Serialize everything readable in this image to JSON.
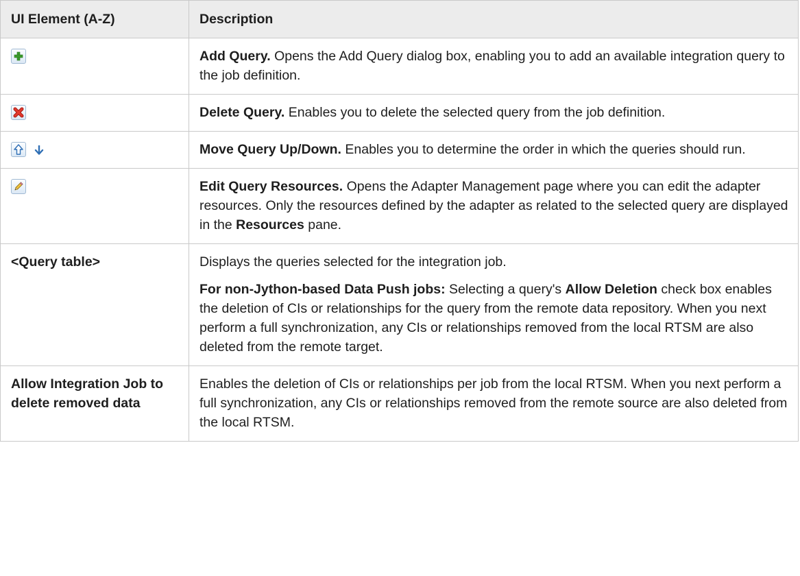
{
  "table": {
    "headers": {
      "element": "UI Element (A-Z)",
      "description": "Description"
    },
    "rows": [
      {
        "icon": "add-icon",
        "title": "Add Query.",
        "desc": " Opens the Add Query dialog box, enabling you to add an available integration query to the job definition."
      },
      {
        "icon": "delete-icon",
        "title": "Delete Query.",
        "desc": " Enables you to delete the selected query from the job definition."
      },
      {
        "icon": "move-up-icon, move-down-icon",
        "title": "Move Query Up/Down.",
        "desc": " Enables you to determine the order in which the queries should run."
      },
      {
        "icon": "edit-pencil-icon",
        "title": "Edit Query Resources.",
        "desc_a": " Opens the Adapter Management page where you can edit the adapter resources. Only the resources defined by the adapter as related to the selected query are displayed in the ",
        "bold": "Resources",
        "desc_b": " pane."
      },
      {
        "element": "<Query table>",
        "p1": "Displays the queries selected for the integration job.",
        "lead": "For non-Jython-based Data Push jobs:",
        "mid_a": " Selecting a query's ",
        "bold": "Allow Deletion",
        "mid_b": " check box enables the deletion of CIs or relationships for the query from the remote data repository. When you next perform a full synchronization, any CIs or relationships removed from the local RTSM are also deleted from the remote target."
      },
      {
        "element": "Allow Integration Job to delete removed data",
        "desc": "Enables the deletion of CIs or relationships per job from the local RTSM. When you next perform a full synchronization, any CIs or relationships removed from the remote source are also deleted from the local RTSM."
      }
    ]
  },
  "colors": {
    "header_bg": "#ececec",
    "border": "#c9c9c9",
    "add_green": "#3a9a2c",
    "delete_red": "#d62b22",
    "arrow_blue": "#2f6fb5"
  }
}
